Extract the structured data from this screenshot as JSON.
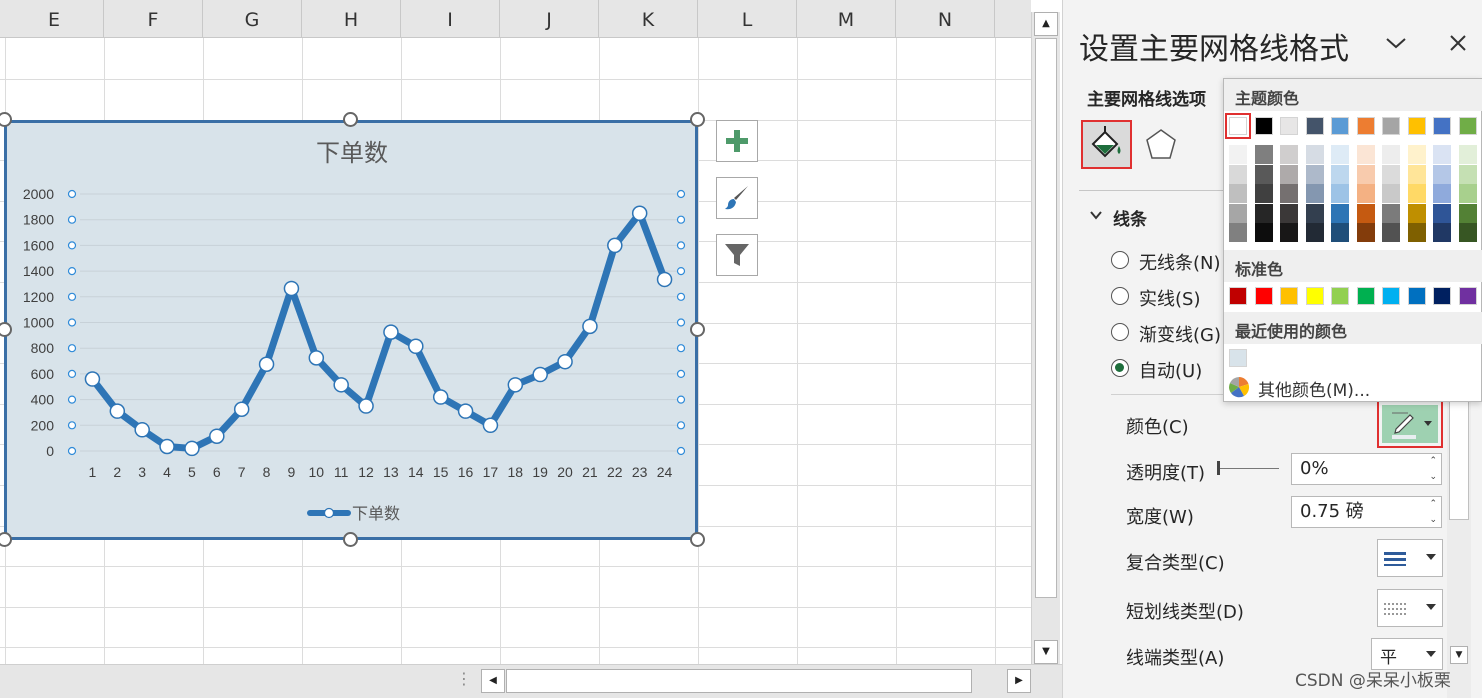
{
  "columns": [
    "E",
    "F",
    "G",
    "H",
    "I",
    "J",
    "K",
    "L",
    "M",
    "N"
  ],
  "chart_data": {
    "type": "line",
    "title": "下单数",
    "categories": [
      "1",
      "2",
      "3",
      "4",
      "5",
      "6",
      "7",
      "8",
      "9",
      "10",
      "11",
      "12",
      "13",
      "14",
      "15",
      "16",
      "17",
      "18",
      "19",
      "20",
      "21",
      "22",
      "23",
      "24"
    ],
    "series": [
      {
        "name": "下单数",
        "values": [
          560,
          310,
          165,
          35,
          20,
          115,
          325,
          675,
          1265,
          725,
          515,
          350,
          925,
          815,
          420,
          310,
          200,
          515,
          595,
          695,
          970,
          1600,
          1850,
          1335
        ]
      }
    ],
    "ylim": [
      0,
      2000
    ],
    "yticks": [
      "0",
      "200",
      "400",
      "600",
      "800",
      "1000",
      "1200",
      "1400",
      "1600",
      "1800",
      "2000"
    ],
    "legend": "bottom",
    "grid": true,
    "line_color": "#2e75b6",
    "background": "#d8e3ea"
  },
  "pane": {
    "title": "设置主要网格线格式",
    "options_tab": "主要网格线选项",
    "section_line": "线条",
    "radios": [
      {
        "label": "无线条(N)",
        "checked": false
      },
      {
        "label": "实线(S)",
        "checked": false
      },
      {
        "label": "渐变线(G)",
        "checked": false
      },
      {
        "label": "自动(U)",
        "checked": true
      }
    ],
    "color_label": "颜色(C)",
    "transparency_label": "透明度(T)",
    "transparency_value": "0%",
    "width_label": "宽度(W)",
    "width_value": "0.75 磅",
    "compound_label": "复合类型(C)",
    "dash_label": "短划线类型(D)",
    "cap_label": "线端类型(A)",
    "cap_value": "平"
  },
  "color_popup": {
    "theme_label": "主题颜色",
    "standard_label": "标准色",
    "recent_label": "最近使用的颜色",
    "other_label": "其他颜色(M)...",
    "theme_top": [
      "#ffffff",
      "#000000",
      "#e7e6e6",
      "#44546a",
      "#5b9bd5",
      "#ed7d31",
      "#a5a5a5",
      "#ffc000",
      "#4472c4",
      "#70ad47"
    ],
    "theme_shades": [
      [
        "#f2f2f2",
        "#d9d9d9",
        "#bfbfbf",
        "#a6a6a6",
        "#808080"
      ],
      [
        "#7f7f7f",
        "#595959",
        "#404040",
        "#262626",
        "#0d0d0d"
      ],
      [
        "#d0cece",
        "#aeaaaa",
        "#757070",
        "#3b3838",
        "#181717"
      ],
      [
        "#d6dce4",
        "#adb9ca",
        "#8497b0",
        "#333f4f",
        "#222a35"
      ],
      [
        "#deebf6",
        "#bdd7ee",
        "#9dc3e6",
        "#2e75b5",
        "#1f4e79"
      ],
      [
        "#fbe5d5",
        "#f8cbad",
        "#f4b183",
        "#c55a11",
        "#833c0b"
      ],
      [
        "#ededed",
        "#dbdbdb",
        "#c9c9c9",
        "#7b7b7b",
        "#525252"
      ],
      [
        "#fff2cc",
        "#ffe599",
        "#ffd966",
        "#bf8f00",
        "#7f6000"
      ],
      [
        "#dae3f3",
        "#b4c7e7",
        "#8faadc",
        "#2f5597",
        "#203864"
      ],
      [
        "#e2efd9",
        "#c5e0b3",
        "#a8d08d",
        "#538135",
        "#375623"
      ]
    ],
    "standard": [
      "#c00000",
      "#ff0000",
      "#ffc000",
      "#ffff00",
      "#92d050",
      "#00b050",
      "#00b0f0",
      "#0070c0",
      "#002060",
      "#7030a0"
    ],
    "recent": [
      "#d8e3ea"
    ]
  },
  "watermark": "CSDN @呆呆小板栗"
}
